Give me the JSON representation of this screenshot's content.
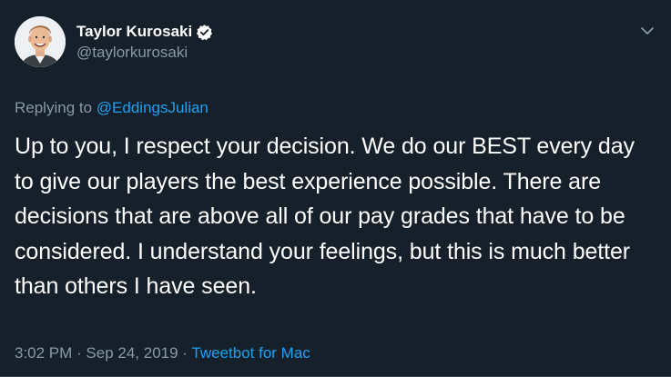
{
  "author": {
    "display_name": "Taylor Kurosaki",
    "handle": "@taylorkurosaki",
    "verified": true,
    "avatar_icon": "avatar-cartoon-portrait"
  },
  "reply": {
    "prefix": "Replying to ",
    "mention": "@EddingsJulian"
  },
  "tweet": {
    "text": "Up to you, I respect your decision. We do our BEST every day to give our players the best experience possible. There are decisions that are above all of our pay grades that have to be considered. I understand your feelings, but this is much better than others I have seen."
  },
  "meta": {
    "time": "3:02 PM",
    "separator1": " · ",
    "date": "Sep 24, 2019",
    "separator2": " · ",
    "source": "Tweetbot for Mac"
  },
  "colors": {
    "background": "#15202b",
    "text_primary": "#ffffff",
    "text_secondary": "#8899a6",
    "accent": "#1da1f2"
  }
}
